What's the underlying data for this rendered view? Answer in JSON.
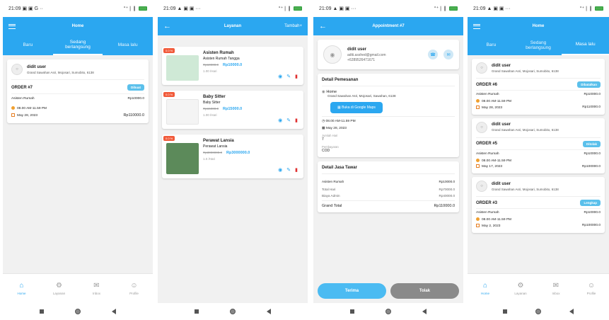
{
  "status_time1": "21:09",
  "status_icons1": "▣ ▣ G ··",
  "status_time2": "21:09",
  "status_icons2": "▲ ▣ ▣ ···",
  "signal": "°⁺❘❙",
  "screen1": {
    "title": "Home",
    "tabs": [
      "Baru",
      "Sedang\nberlangsung",
      "Masa lalu"
    ],
    "order": {
      "user": "didit user",
      "address": "Grand Sawahan Asri, Mojosari, Sumobito, 6138",
      "order_no": "ORDER #7",
      "badge": "Dibuat",
      "service": "Asisten Rumah",
      "service_price": "Rp10000.0",
      "time": "08.00 AM-11.59 PM",
      "date": "May 28, 2023",
      "total": "Rp110000.0"
    }
  },
  "screen2": {
    "title": "Layanan",
    "action": "Tambah+",
    "services": [
      {
        "disc": "0.0 %",
        "title": "Asisten Rumah",
        "subtitle": "Asisten Rumah Tangga",
        "old": "Rp10000.0",
        "price": "Rp10000.0",
        "unit": "1.00 /Hari"
      },
      {
        "disc": "0.0 %",
        "title": "Baby Sitter",
        "subtitle": "Baby Sitter",
        "old": "Rp15000.0",
        "price": "Rp15000.0",
        "unit": "1.00 /Hari"
      },
      {
        "disc": "0.0 %",
        "title": "Perawat Lansia",
        "subtitle": "Perawat Lansia",
        "old": "Rp3000000.0",
        "price": "Rp3000000.0",
        "unit": "1.0 /Hari"
      }
    ]
  },
  "screen3": {
    "title": "Appointment #7",
    "user": "didit user",
    "email": "aditi.asshed@gmail.com",
    "phone": "+6289526471671",
    "detail_title": "Detail Pemesanan",
    "place": "Home",
    "address": "Grand Sawahan Asri, Mojosari, Sawahan, 6138",
    "maps_label": "Buka di Google Maps",
    "time": "08.00 AM-11.59 PM",
    "date": "May 28, 2023",
    "qty_label": "Jumlah Hari",
    "qty_value": "7",
    "payment_label": "Pembayaran",
    "payment_value": "COD",
    "fee_title": "Detail Jasa Tawar",
    "fee_row1_label": "Asisten Rumah",
    "fee_row1_value": "Rp10000.0",
    "fee_row2_label": "Total Hari",
    "fee_row2_value": "Rp70000.0",
    "fee_row3_label": "Biaya Admin",
    "fee_row3_value": "Rp40000.0",
    "grand_label": "Grand Total",
    "grand_value": "Rp110000.0",
    "accept": "Terima",
    "reject": "Tolak"
  },
  "screen4": {
    "title": "Home",
    "tabs": [
      "Baru",
      "Sedang\nberlangsung",
      "Masa lalu"
    ],
    "orders": [
      {
        "user": "didit user",
        "address": "Grand Sawahan Asri, Mojosari, Sumobito, 6138",
        "order_no": "ORDER #6",
        "badge": "Dibatalkan",
        "service": "Asisten Rumah",
        "service_price": "Rp10000.0",
        "time": "08.00 AM-11.59 PM",
        "date": "May 28, 2023",
        "total": "Rp110000.0"
      },
      {
        "user": "didit user",
        "address": "Grand Sawahan Asri, Mojosari, Sumobito, 6138",
        "order_no": "ORDER #5",
        "badge": "Ditolak",
        "service": "Asisten Rumah",
        "service_price": "Rp10000.0",
        "time": "08.00 AM-11.59 PM",
        "date": "May 17, 2023",
        "total": "Rp100000.0"
      },
      {
        "user": "didit user",
        "address": "Grand Sawahan Asri, Mojosari, Sumobito, 6138",
        "order_no": "ORDER #3",
        "badge": "Lengkap",
        "service": "Asisten Rumah",
        "service_price": "Rp10000.0",
        "time": "08.00 AM-11.59 PM",
        "date": "May 2, 2023",
        "total": "Rp100000.0"
      }
    ]
  },
  "nav": [
    "Home",
    "Layanan",
    "Inbox",
    "Profile"
  ],
  "colors": {
    "primary": "#2ba7f0",
    "danger": "#e03030",
    "gray_button": "#8a8a8a"
  }
}
